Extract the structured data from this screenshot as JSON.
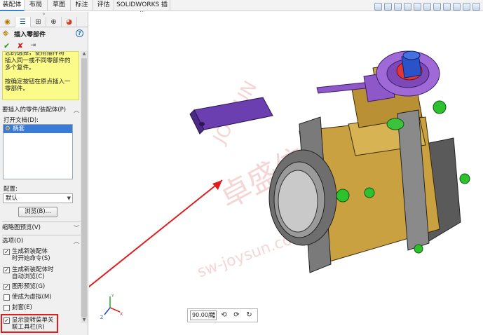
{
  "tabs": [
    "装配体",
    "布局",
    "草图",
    "标注",
    "评估",
    "SOLIDWORKS 插件"
  ],
  "panel": {
    "title": "插入零部件",
    "help": "?",
    "message_lines": [
      "您的选择，使用插件将",
      "插入同一或不同零部件的",
      "多个复件。"
    ],
    "message_2_lines": [
      "按确定按钮在原点插入一",
      "零部件。"
    ],
    "section_part": "要插入的零件/装配体(P)",
    "open_docs_label": "打开文档(D):",
    "open_docs": [
      "柄套"
    ],
    "config_label": "配置:",
    "config_value": "默认",
    "browse_label": "浏览(B)...",
    "thumb_preview": "缩略图预览(V)",
    "options_label": "选项(O)",
    "options": [
      {
        "l1": "生成新装配体",
        "l2": "时开始命令(S)",
        "checked": true
      },
      {
        "l1": "生成新装配体时",
        "l2": "自动浏览(C)",
        "checked": true
      },
      {
        "l1": "图形预览(G)",
        "l2": "",
        "checked": true
      },
      {
        "l1": "使成为虚拟(M)",
        "l2": "",
        "checked": false
      },
      {
        "l1": "封套(E)",
        "l2": "",
        "checked": false
      },
      {
        "l1": "显示旋转菜单关",
        "l2": "联工具栏(R)",
        "checked": true
      }
    ]
  },
  "viewport": {
    "angle_value": "90.00度",
    "watermark": "卓盛信息",
    "watermark_url": "sw-joysun.com",
    "watermark_brand": "JOYSUN",
    "triad": {
      "x": "X",
      "y": "Y",
      "z": "Z"
    }
  },
  "colors": {
    "accent": "#3b7fd1",
    "highlight": "#e21b1b",
    "message_bg": "#fbfb8a"
  }
}
